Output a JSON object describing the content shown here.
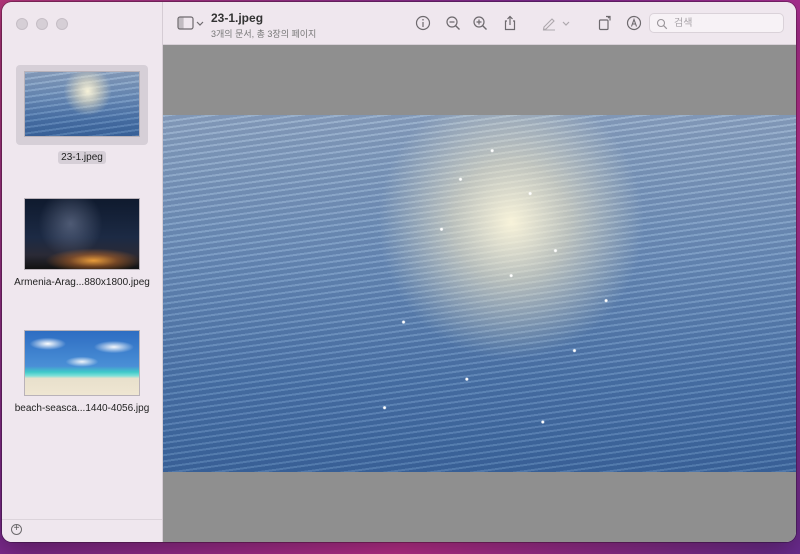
{
  "window": {
    "traffic_lights": [
      "close",
      "minimize",
      "zoom"
    ]
  },
  "toolbar": {
    "title": "23-1.jpeg",
    "subtitle": "3개의 문서, 총 3장의 페이지",
    "icons": [
      "sidebar-toggle-icon",
      "info-icon",
      "zoom-out-icon",
      "zoom-in-icon",
      "share-icon",
      "markup-pen-icon",
      "rotate-icon",
      "annotate-icon"
    ],
    "search": {
      "placeholder": "검색",
      "value": ""
    }
  },
  "sidebar": {
    "thumbnails": [
      {
        "label": "23-1.jpeg",
        "selected": true,
        "image": "sea"
      },
      {
        "label": "Armenia-Arag...880x1800.jpeg",
        "selected": false,
        "image": "night-sky"
      },
      {
        "label": "beach-seasca...1440-4056.jpg",
        "selected": false,
        "image": "beach"
      }
    ],
    "add_button": "+"
  },
  "colors": {
    "window_bg": "#efe7ee",
    "content_bg": "#8f8f8f",
    "selection": "#d6cfd7"
  }
}
